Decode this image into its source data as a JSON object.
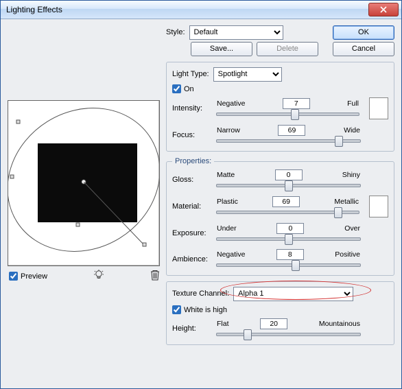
{
  "window": {
    "title": "Lighting Effects"
  },
  "buttons": {
    "ok": "OK",
    "cancel": "Cancel",
    "save": "Save...",
    "delete": "Delete"
  },
  "style": {
    "label": "Style:",
    "value": "Default"
  },
  "preview": {
    "label": "Preview",
    "checked": true
  },
  "light": {
    "legend": "Light Type:",
    "type": "Spotlight",
    "on_label": "On",
    "on": true,
    "intensity": {
      "label": "Intensity:",
      "left": "Negative",
      "right": "Full",
      "value": "7",
      "pos": 55
    },
    "focus": {
      "label": "Focus:",
      "left": "Narrow",
      "right": "Wide",
      "value": "69",
      "pos": 85
    }
  },
  "props": {
    "legend": "Properties:",
    "gloss": {
      "label": "Gloss:",
      "left": "Matte",
      "right": "Shiny",
      "value": "0",
      "pos": 50
    },
    "material": {
      "label": "Material:",
      "left": "Plastic",
      "right": "Metallic",
      "value": "69",
      "pos": 85
    },
    "exposure": {
      "label": "Exposure:",
      "left": "Under",
      "right": "Over",
      "value": "0",
      "pos": 50
    },
    "ambience": {
      "label": "Ambience:",
      "left": "Negative",
      "right": "Positive",
      "value": "8",
      "pos": 55
    }
  },
  "texture": {
    "label": "Texture Channel:",
    "value": "Alpha 1",
    "white_label": "White is high",
    "white": true,
    "height": {
      "label": "Height:",
      "left": "Flat",
      "right": "Mountainous",
      "value": "20",
      "pos": 22
    }
  }
}
